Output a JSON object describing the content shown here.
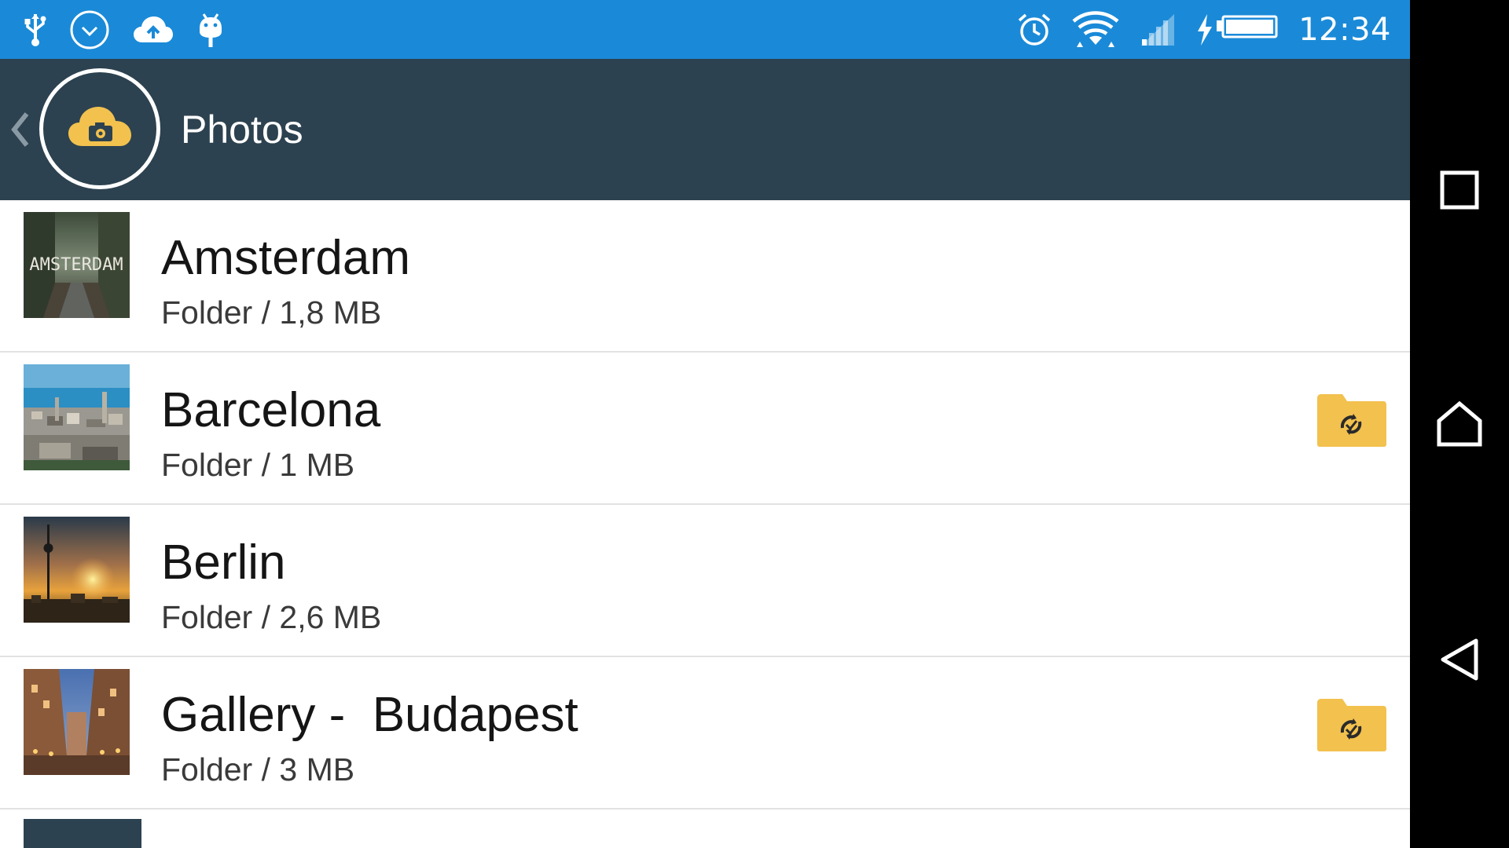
{
  "status_bar": {
    "time": "12:34",
    "left_icons": [
      "usb-icon",
      "download-circle-icon",
      "cloud-upload-icon",
      "android-debug-icon"
    ],
    "right_icons": [
      "alarm-icon",
      "wifi-icon",
      "cellular-signal-icon",
      "battery-charging-icon"
    ]
  },
  "header": {
    "title": "Photos",
    "logo_icon": "cloud-camera-icon",
    "back_icon": "chevron-left-icon"
  },
  "folders": [
    {
      "name": "Amsterdam",
      "meta": "Folder / 1,8 MB",
      "synced": false,
      "thumb_text": "AMSTERDAM"
    },
    {
      "name": "Barcelona",
      "meta": "Folder / 1 MB",
      "synced": true
    },
    {
      "name": "Berlin",
      "meta": "Folder / 2,6 MB",
      "synced": false
    },
    {
      "name": "Gallery -  Budapest",
      "meta": "Folder / 3 MB",
      "synced": true
    }
  ],
  "nav_bar": {
    "buttons": [
      "recents-icon",
      "home-icon",
      "back-icon"
    ]
  },
  "colors": {
    "status_bar": "#1a8ad8",
    "action_bar": "#2d4250",
    "accent_gold": "#f2c14e",
    "nav_bar": "#000000"
  }
}
